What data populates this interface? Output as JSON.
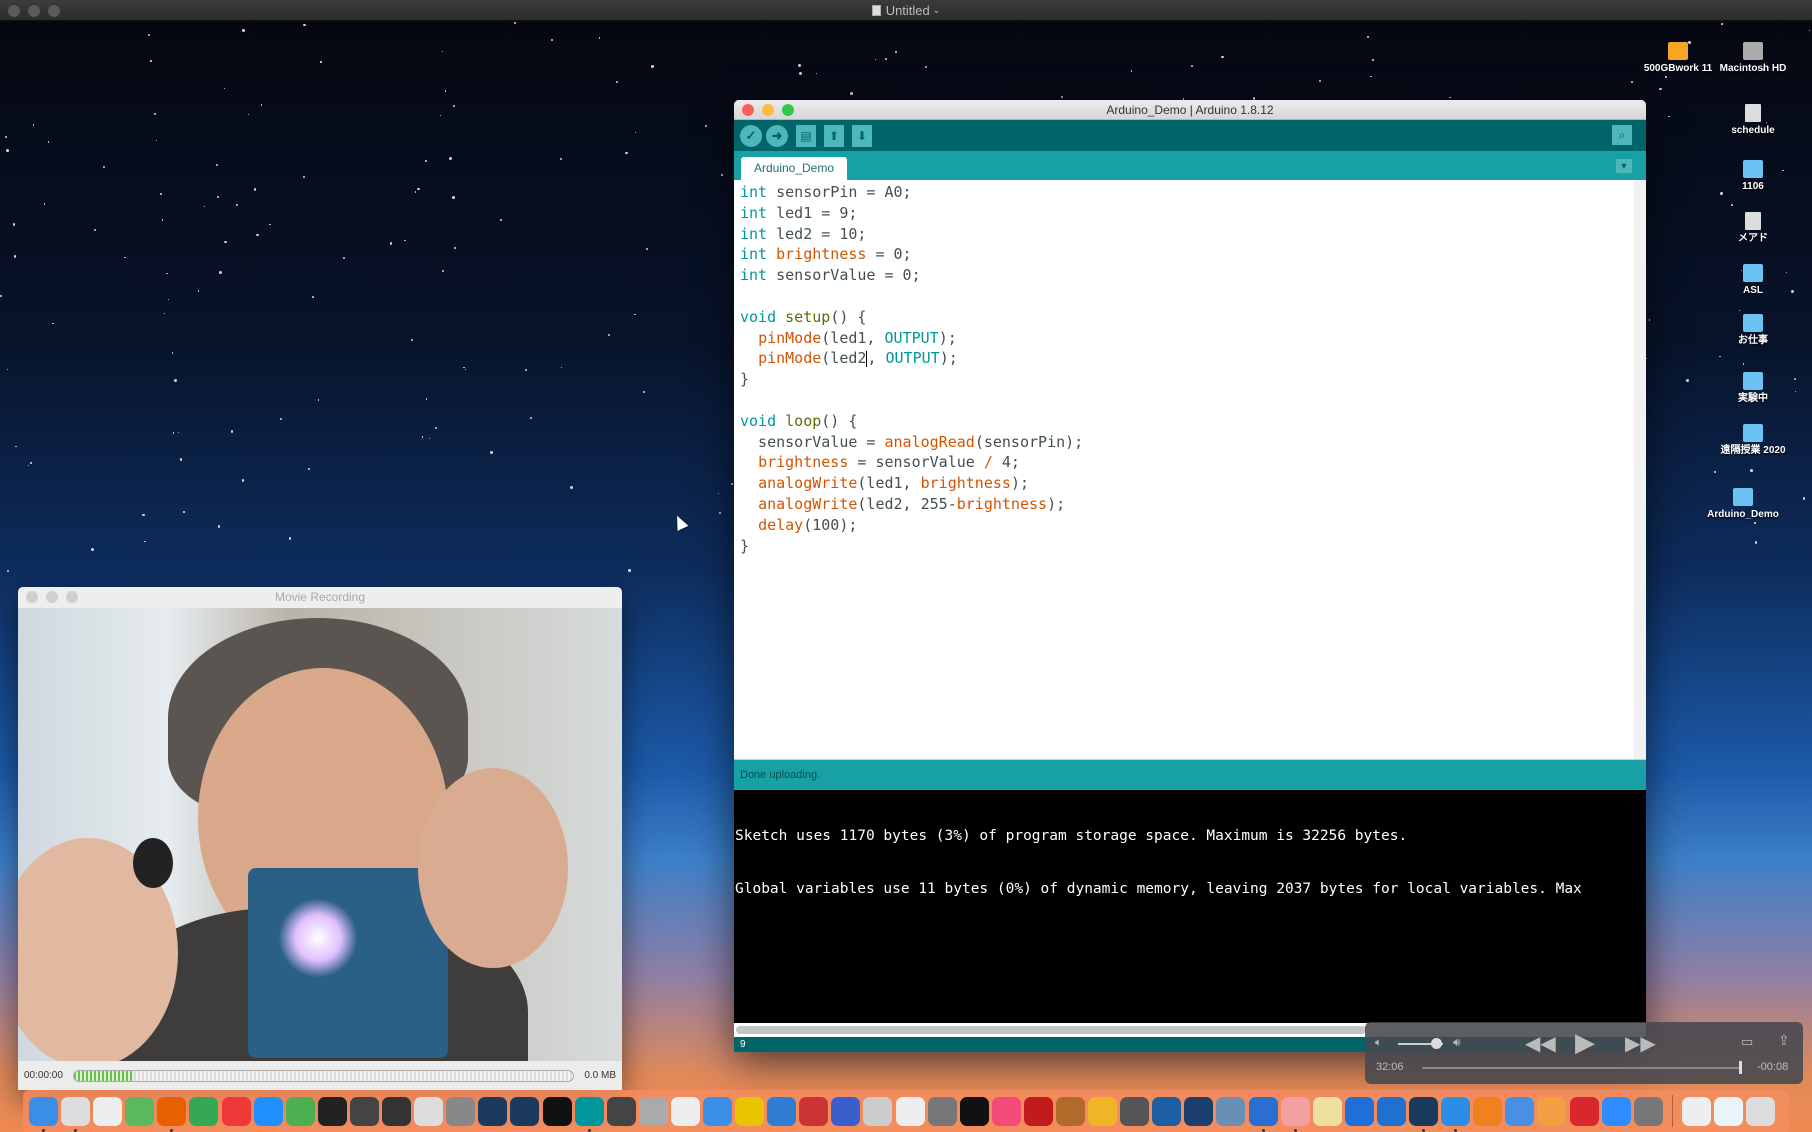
{
  "screen_title": "Untitled",
  "desktop_icons": [
    {
      "label": "500GBwork 11",
      "kind": "drive-o"
    },
    {
      "label": "Macintosh HD",
      "kind": "drive-g"
    },
    {
      "label": "schedule",
      "kind": "file"
    },
    {
      "label": "1106",
      "kind": "folder"
    },
    {
      "label": "メアド",
      "kind": "file"
    },
    {
      "label": "ASL",
      "kind": "folder"
    },
    {
      "label": "お仕事",
      "kind": "folder"
    },
    {
      "label": "実験中",
      "kind": "folder"
    },
    {
      "label": "遠隔授業 2020",
      "kind": "folder"
    },
    {
      "label": "Arduino_Demo",
      "kind": "folder"
    }
  ],
  "arduino": {
    "title": "Arduino_Demo | Arduino 1.8.12",
    "toolbar": {
      "verify": "✓",
      "upload": "➜",
      "new": "▤",
      "open": "⬆",
      "save": "⬇",
      "serial": "⌕"
    },
    "tab": "Arduino_Demo",
    "code": [
      [
        [
          "int",
          "k"
        ],
        [
          " sensorPin = A0;",
          ""
        ]
      ],
      [
        [
          "int",
          "k"
        ],
        [
          " led1 = 9;",
          ""
        ]
      ],
      [
        [
          "int",
          "k"
        ],
        [
          " led2 = 10;",
          ""
        ]
      ],
      [
        [
          "int",
          "k"
        ],
        [
          " ",
          ""
        ],
        [
          "brightness",
          "o"
        ],
        [
          " = 0;",
          ""
        ]
      ],
      [
        [
          "int",
          "k"
        ],
        [
          " sensorValue = 0;",
          ""
        ]
      ],
      [],
      [
        [
          "void",
          "k"
        ],
        [
          " ",
          ""
        ],
        [
          "setup",
          "s"
        ],
        [
          "() {",
          ""
        ]
      ],
      [
        [
          "  ",
          ""
        ],
        [
          "pinMode",
          "f"
        ],
        [
          "(led1, ",
          ""
        ],
        [
          "OUTPUT",
          "k"
        ],
        [
          ");",
          ""
        ]
      ],
      [
        [
          "  ",
          ""
        ],
        [
          "pinMode",
          "f"
        ],
        [
          "(led2",
          ""
        ],
        [
          "|",
          "caret"
        ],
        [
          ", ",
          ""
        ],
        [
          "OUTPUT",
          "k"
        ],
        [
          ");",
          ""
        ]
      ],
      [
        [
          "}",
          ""
        ]
      ],
      [],
      [
        [
          "void",
          "k"
        ],
        [
          " ",
          ""
        ],
        [
          "loop",
          "s"
        ],
        [
          "() {",
          ""
        ]
      ],
      [
        [
          "  sensorValue = ",
          ""
        ],
        [
          "analogRead",
          "f"
        ],
        [
          "(sensorPin);",
          ""
        ]
      ],
      [
        [
          "  ",
          ""
        ],
        [
          "brightness",
          "o"
        ],
        [
          " = sensorValue ",
          ""
        ],
        [
          "/",
          "o"
        ],
        [
          " 4;",
          ""
        ]
      ],
      [
        [
          "  ",
          ""
        ],
        [
          "analogWrite",
          "f"
        ],
        [
          "(led1, ",
          ""
        ],
        [
          "brightness",
          "o"
        ],
        [
          ");",
          ""
        ]
      ],
      [
        [
          "  ",
          ""
        ],
        [
          "analogWrite",
          "f"
        ],
        [
          "(led2, 255-",
          ""
        ],
        [
          "brightness",
          "o"
        ],
        [
          ");",
          ""
        ]
      ],
      [
        [
          "  ",
          ""
        ],
        [
          "delay",
          "f"
        ],
        [
          "(100);",
          ""
        ]
      ],
      [
        [
          "}",
          ""
        ]
      ]
    ],
    "status": "Done uploading.",
    "console": [
      "Sketch uses 1170 bytes (3%) of program storage space. Maximum is 32256 bytes.",
      "Global variables use 11 bytes (0%) of dynamic memory, leaving 2037 bytes for local variables. Max"
    ],
    "line_number": "9"
  },
  "movie": {
    "title": "Movie Recording",
    "elapsed": "00:00:00",
    "size": "0.0 MB",
    "level": 0.12
  },
  "quicktime": {
    "current": "32:06",
    "remaining": "-00:08",
    "progress": 0.99,
    "volume": 0.85
  },
  "dock": [
    {
      "name": "finder",
      "color": "#3a8ee6",
      "run": true
    },
    {
      "name": "script-editor",
      "color": "#ddd",
      "run": true
    },
    {
      "name": "textedit",
      "color": "#eee"
    },
    {
      "name": "numbers",
      "color": "#5cb85c"
    },
    {
      "name": "firefox",
      "color": "#e66000",
      "run": true
    },
    {
      "name": "chrome",
      "color": "#34a853"
    },
    {
      "name": "vivaldi",
      "color": "#ef3939"
    },
    {
      "name": "safari",
      "color": "#1e90ff"
    },
    {
      "name": "bbedit",
      "color": "#4caf50"
    },
    {
      "name": "terminal",
      "color": "#222"
    },
    {
      "name": "app-7",
      "color": "#444"
    },
    {
      "name": "app-8",
      "color": "#333"
    },
    {
      "name": "pure-data",
      "color": "#ddd"
    },
    {
      "name": "virtualbox",
      "color": "#888"
    },
    {
      "name": "processing-p5",
      "color": "#1c3a5e"
    },
    {
      "name": "processing",
      "color": "#1c3a5e"
    },
    {
      "name": "p13",
      "color": "#111"
    },
    {
      "name": "arduino",
      "color": "#00979c",
      "run": true
    },
    {
      "name": "app-robot",
      "color": "#444"
    },
    {
      "name": "app-drive",
      "color": "#aaa"
    },
    {
      "name": "app-windmill",
      "color": "#eee"
    },
    {
      "name": "xcode",
      "color": "#3a8ee6"
    },
    {
      "name": "app-wave",
      "color": "#e8c500"
    },
    {
      "name": "app-triangle",
      "color": "#2e7dd1"
    },
    {
      "name": "app-tools",
      "color": "#c33"
    },
    {
      "name": "app-pen",
      "color": "#3a5fcd"
    },
    {
      "name": "app-scanner",
      "color": "#ccc"
    },
    {
      "name": "app-photo",
      "color": "#eee"
    },
    {
      "name": "app-disc",
      "color": "#777"
    },
    {
      "name": "piano",
      "color": "#111"
    },
    {
      "name": "itunes",
      "color": "#f54b7b"
    },
    {
      "name": "flash",
      "color": "#c21b1b"
    },
    {
      "name": "garageband",
      "color": "#b06b2b"
    },
    {
      "name": "app-check",
      "color": "#f0b429"
    },
    {
      "name": "app-speaker",
      "color": "#555"
    },
    {
      "name": "app-free",
      "color": "#1e5fa3"
    },
    {
      "name": "app-house",
      "color": "#1c3f6e"
    },
    {
      "name": "preview",
      "color": "#6a8fb5"
    },
    {
      "name": "intel-power",
      "color": "#2a6ed1",
      "run": true
    },
    {
      "name": "app-graph",
      "color": "#f0a0a0",
      "run": true
    },
    {
      "name": "app-apr",
      "color": "#f0e0a0"
    },
    {
      "name": "app-circle",
      "color": "#1e6fd9"
    },
    {
      "name": "claquette",
      "color": "#2070d0"
    },
    {
      "name": "quicktime",
      "color": "#1a3a5e",
      "run": true
    },
    {
      "name": "quicktime-7",
      "color": "#2a8ee6",
      "run": true
    },
    {
      "name": "vlc",
      "color": "#f08020"
    },
    {
      "name": "keynote",
      "color": "#4a90e2"
    },
    {
      "name": "pages",
      "color": "#f0a040"
    },
    {
      "name": "mega",
      "color": "#d9272e"
    },
    {
      "name": "zoom",
      "color": "#2d8cff"
    },
    {
      "name": "system-preferences",
      "color": "#777"
    },
    {
      "sep": true
    },
    {
      "name": "downloads-stack",
      "color": "#eee"
    },
    {
      "name": "documents-stack",
      "color": "#e8f4f8"
    },
    {
      "name": "trash",
      "color": "#ddd"
    }
  ]
}
